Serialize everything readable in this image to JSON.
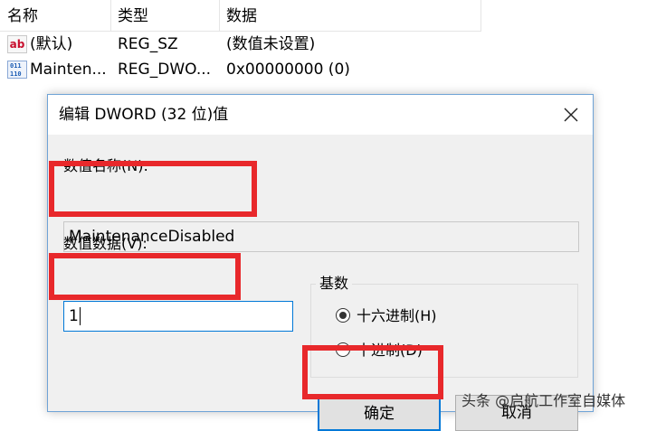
{
  "registry": {
    "headers": {
      "name": "名称",
      "type": "类型",
      "data": "数据"
    },
    "rows": [
      {
        "icon": "string-value-icon",
        "name": "(默认)",
        "type": "REG_SZ",
        "data": "(数值未设置)"
      },
      {
        "icon": "binary-value-icon",
        "name": "Mainten...",
        "type": "REG_DWO...",
        "data": "0x00000000 (0)"
      }
    ]
  },
  "dialog": {
    "title": "编辑 DWORD (32 位)值",
    "value_name_label": "数值名称(N):",
    "value_name": "MaintenanceDisabled",
    "value_data_label": "数值数据(V):",
    "value_data": "1",
    "base": {
      "title": "基数",
      "options": [
        {
          "label": "十六进制(H)",
          "selected": true
        },
        {
          "label": "十进制(D)",
          "selected": false
        }
      ]
    },
    "ok_label": "确定",
    "cancel_label": "取消"
  },
  "annotations": {
    "highlight_color": "#e8282b"
  },
  "watermark": "头条 @启航工作室自媒体",
  "colors": {
    "accent": "#0078d7",
    "dialog_body": "#f0f0f0"
  }
}
